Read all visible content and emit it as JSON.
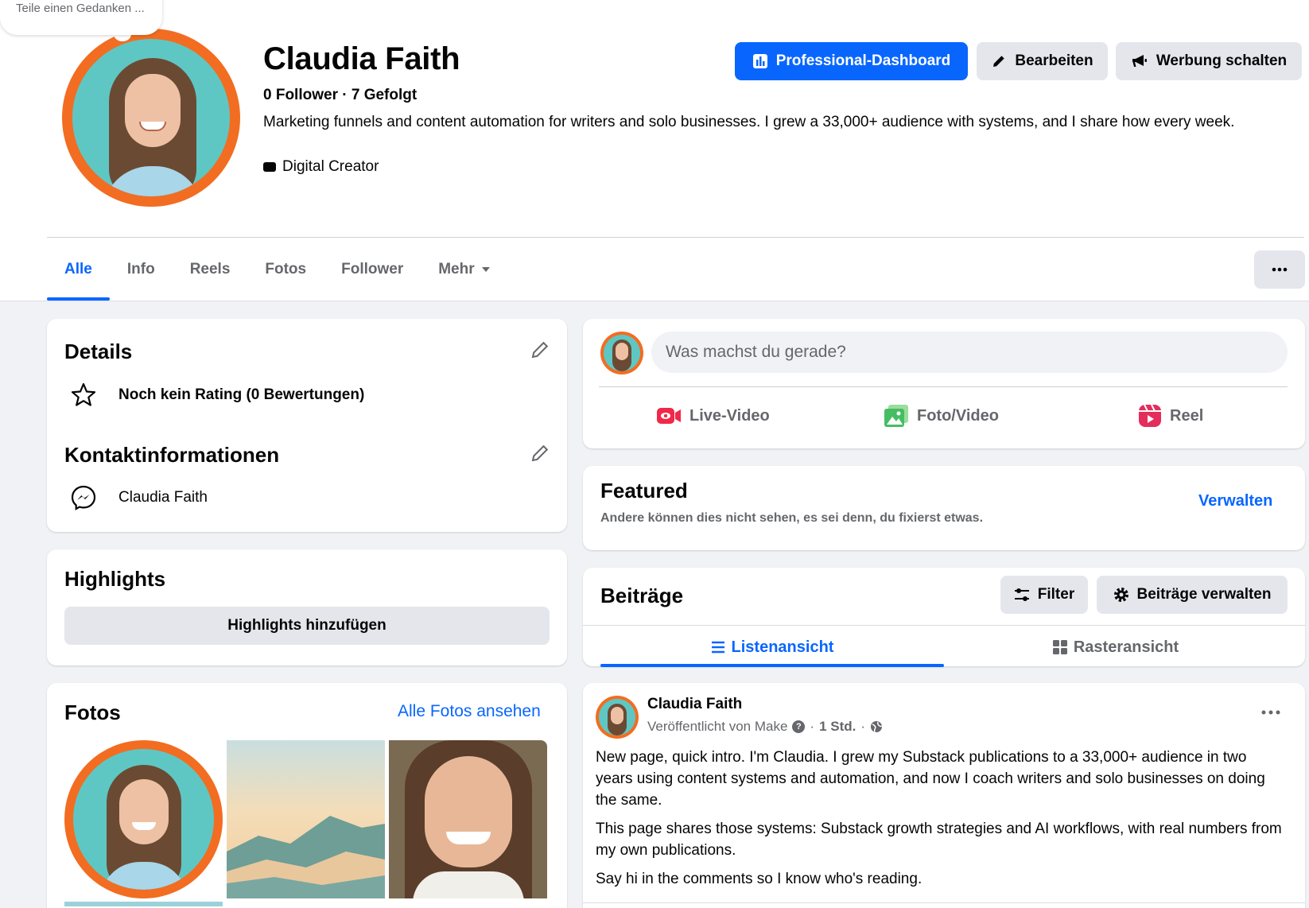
{
  "thought_bubble": "Teile einen Gedanken ...",
  "profile": {
    "name": "Claudia Faith",
    "follow_line": "0 Follower · 7 Gefolgt",
    "bio": "Marketing funnels and content automation for writers and solo businesses. I grew a 33,000+ audience with systems, and I share how every week.",
    "category": "Digital Creator"
  },
  "actions": {
    "dashboard": "Professional-Dashboard",
    "edit": "Bearbeiten",
    "ads": "Werbung schalten"
  },
  "tabs": [
    {
      "label": "Alle",
      "active": true
    },
    {
      "label": "Info"
    },
    {
      "label": "Reels"
    },
    {
      "label": "Fotos"
    },
    {
      "label": "Follower"
    },
    {
      "label": "Mehr"
    }
  ],
  "details": {
    "title": "Details",
    "rating": "Noch kein Rating (0 Bewertungen)",
    "contact_title": "Kontaktinformationen",
    "messenger_name": "Claudia Faith"
  },
  "highlights": {
    "title": "Highlights",
    "add_button": "Highlights hinzufügen"
  },
  "photos": {
    "title": "Fotos",
    "see_all": "Alle Fotos ansehen"
  },
  "composer": {
    "placeholder": "Was machst du gerade?",
    "live": "Live-Video",
    "photo": "Foto/Video",
    "reel": "Reel"
  },
  "featured": {
    "title": "Featured",
    "subtitle": "Andere können dies nicht sehen, es sei denn, du fixierst etwas.",
    "manage": "Verwalten"
  },
  "posts": {
    "title": "Beiträge",
    "filter": "Filter",
    "manage": "Beiträge verwalten",
    "list_view": "Listenansicht",
    "grid_view": "Rasteransicht"
  },
  "post": {
    "author": "Claudia Faith",
    "published_by": "Veröffentlicht von Make",
    "time": "1 Std.",
    "paragraphs": [
      "New page, quick intro. I'm Claudia. I grew my Substack publications to a 33,000+ audience in two years using content systems and automation, and now I coach writers and solo businesses on doing the same.",
      "This page shares those systems: Substack growth strategies and AI workflows, with real numbers from my own publications.",
      "Say hi in the comments so I know who's reading."
    ]
  },
  "colors": {
    "accent": "#0866ff",
    "avatar_ring": "#f26d21",
    "avatar_bg": "#5ec7c4",
    "page_bg": "#f0f2f5"
  }
}
